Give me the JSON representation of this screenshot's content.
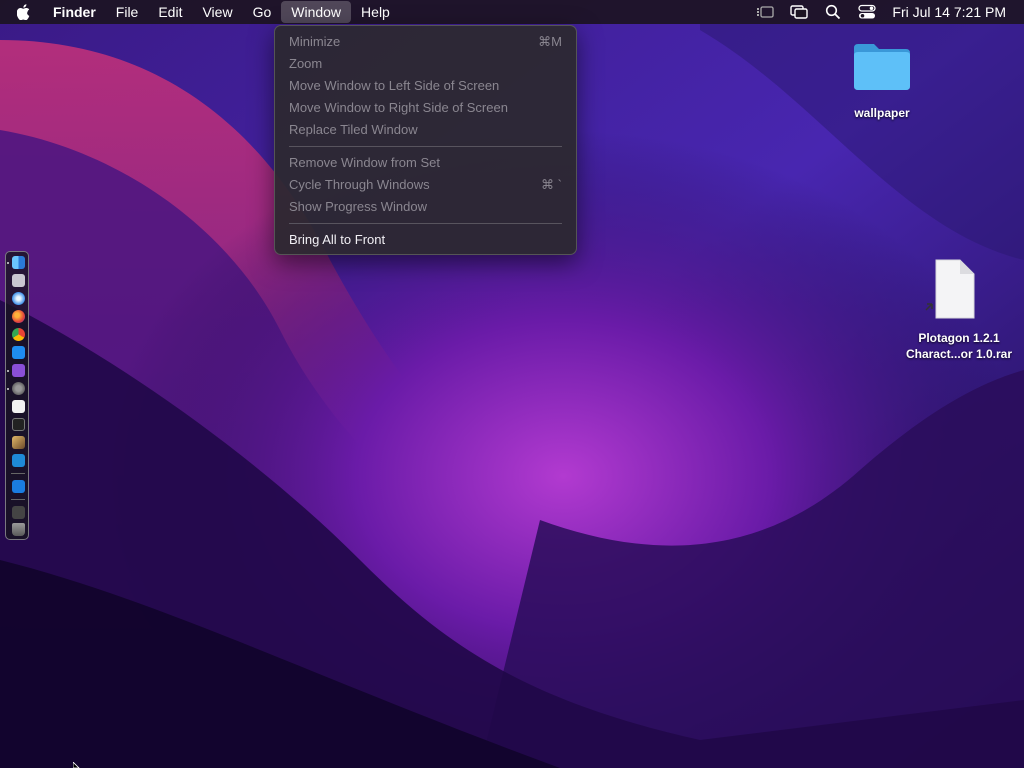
{
  "menubar": {
    "app_name": "Finder",
    "items": [
      "File",
      "Edit",
      "View",
      "Go",
      "Window",
      "Help"
    ],
    "open_menu": "Window",
    "clock": "Fri Jul 14  7:21 PM"
  },
  "window_menu": {
    "items": [
      {
        "label": "Minimize",
        "shortcut": "⌘M",
        "enabled": false
      },
      {
        "label": "Zoom",
        "shortcut": "",
        "enabled": false
      },
      {
        "label": "Move Window to Left Side of Screen",
        "shortcut": "",
        "enabled": false
      },
      {
        "label": "Move Window to Right Side of Screen",
        "shortcut": "",
        "enabled": false
      },
      {
        "label": "Replace Tiled Window",
        "shortcut": "",
        "enabled": false
      },
      {
        "label": "Remove Window from Set",
        "shortcut": "",
        "enabled": false
      },
      {
        "label": "Cycle Through Windows",
        "shortcut": "⌘ `",
        "enabled": false
      },
      {
        "label": "Show Progress Window",
        "shortcut": "",
        "enabled": false
      },
      {
        "label": "Bring All to Front",
        "shortcut": "",
        "enabled": true
      }
    ]
  },
  "desktop": {
    "folder_label": "wallpaper",
    "file_label_line1": "Plotagon 1.2.1",
    "file_label_line2": "Charact...or 1.0.rar"
  },
  "dock": {
    "icons": [
      "finder-icon",
      "launchpad-icon",
      "safari-icon",
      "firefox-icon",
      "chrome-icon",
      "app-store-icon",
      "visual-studio-icon",
      "system-preferences-icon",
      "textedit-icon",
      "terminal-icon",
      "brush-icon",
      "vscode-icon",
      "maxthon-icon",
      "downloads-icon",
      "trash-icon"
    ]
  },
  "colors": {
    "menu_bg": "#2c2830",
    "menu_disabled_text": "#8a8690",
    "menu_enabled_text": "#f2f0f5",
    "folder_blue": "#4fb0f0"
  }
}
